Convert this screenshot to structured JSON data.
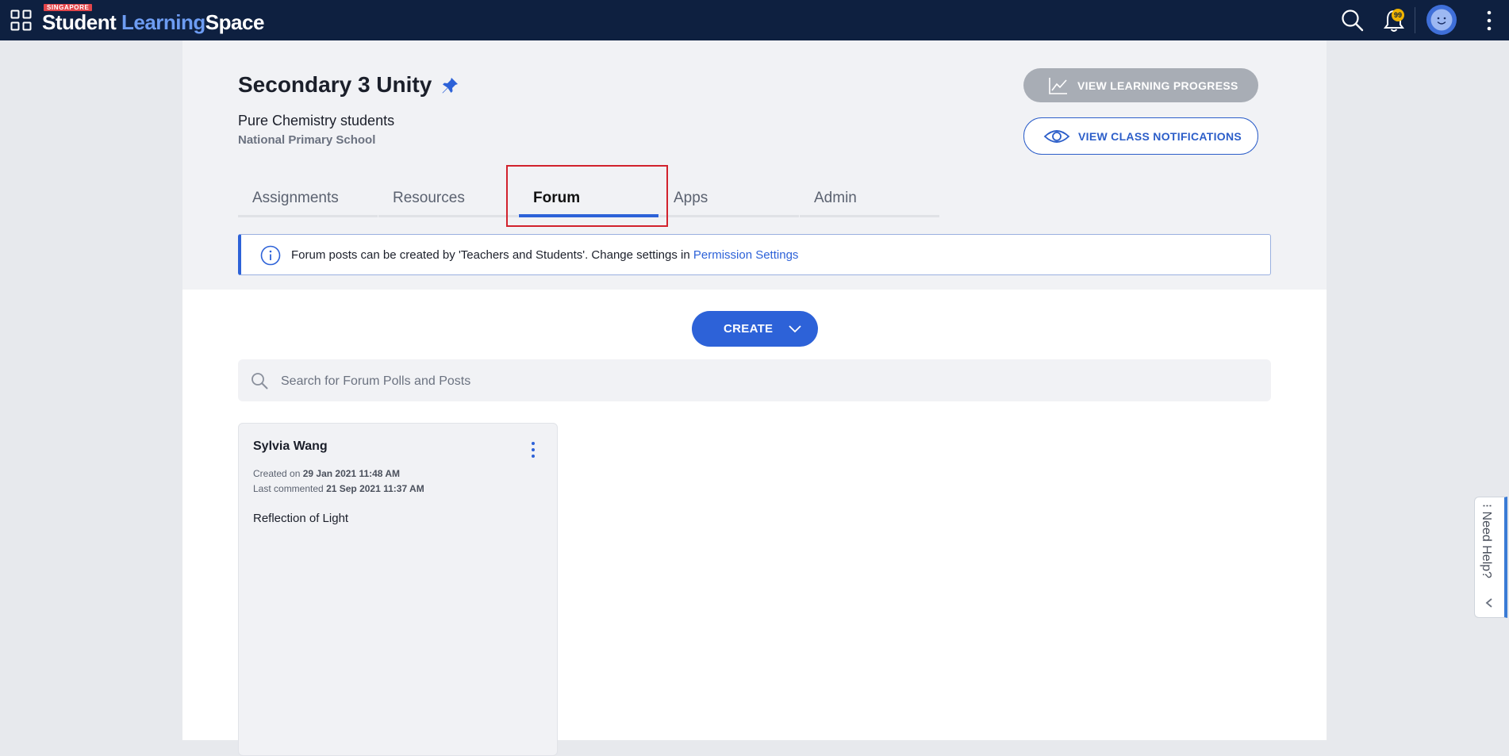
{
  "colors": {
    "topbar": "#0e2040",
    "accent": "#2d62d8",
    "logo_highlight": "#6d9cf2",
    "badge": "#f0b400",
    "highlight_box": "#d2222d"
  },
  "topbar": {
    "logo": {
      "tag": "SINGAPORE",
      "word1": "Student",
      "word2": "Learning",
      "word3": "Space"
    },
    "icons": [
      "apps-grid-icon",
      "search-icon",
      "bell-icon",
      "avatar",
      "kebab-menu-icon"
    ],
    "notification_count": "99"
  },
  "class": {
    "title": "Secondary 3 Unity",
    "subtitle": "Pure Chemistry students",
    "school": "National Primary School"
  },
  "actions": {
    "learning_progress": "VIEW LEARNING PROGRESS",
    "class_notifications": "VIEW CLASS NOTIFICATIONS"
  },
  "tabs": [
    {
      "label": "Assignments",
      "active": false
    },
    {
      "label": "Resources",
      "active": false
    },
    {
      "label": "Forum",
      "active": true
    },
    {
      "label": "Apps",
      "active": false
    },
    {
      "label": "Admin",
      "active": false
    }
  ],
  "info": {
    "text": "Forum posts can be created by 'Teachers and Students'. Change settings in ",
    "link": "Permission Settings"
  },
  "create_button": "CREATE",
  "search": {
    "placeholder": "Search for Forum Polls and Posts",
    "value": ""
  },
  "posts": [
    {
      "author": "Sylvia Wang",
      "created_label": "Created on",
      "created": "29 Jan 2021 11:48 AM",
      "commented_label": "Last commented",
      "commented": "21 Sep 2021 11:37 AM",
      "title": "Reflection of Light"
    }
  ],
  "help": {
    "label": "Need Help?"
  }
}
